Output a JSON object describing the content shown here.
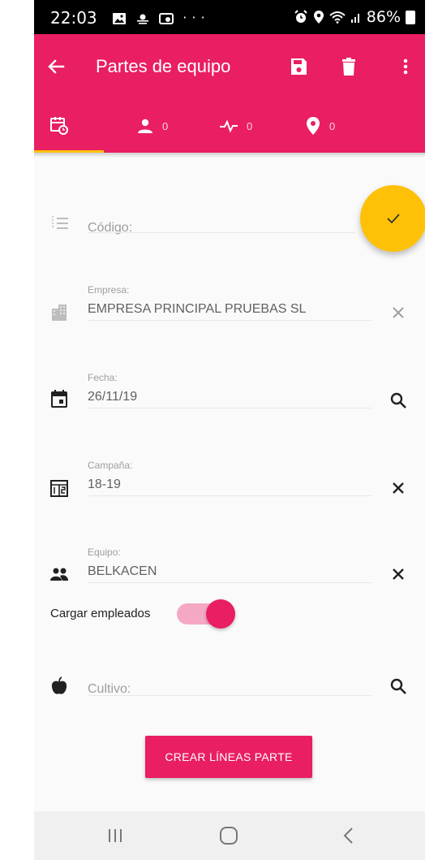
{
  "status_bar": {
    "time": "22:03",
    "left_icons": [
      "gallery-icon",
      "weather-icon",
      "gamepad-icon",
      "more-notifications-icon"
    ],
    "more_glyph": "···",
    "battery": "86%",
    "right_icons": [
      "alarm-icon",
      "location-icon",
      "wifi-icon",
      "signal-icon",
      "battery-icon"
    ]
  },
  "app_bar": {
    "title": "Partes de equipo",
    "icons": [
      "back-arrow-icon",
      "save-icon",
      "delete-icon",
      "more-vert-icon"
    ],
    "background": "#e91e63"
  },
  "tabs": [
    {
      "icon": "calendar-clock-icon",
      "count": ""
    },
    {
      "icon": "person-icon",
      "count": "0"
    },
    {
      "icon": "activity-icon",
      "count": "0"
    },
    {
      "icon": "location-pin-icon",
      "count": "0"
    }
  ],
  "tab_indicator_color": "#ffc107",
  "fab": {
    "icon": "check-icon",
    "color": "#ffc107"
  },
  "form": {
    "codigo": {
      "placeholder": "Código:",
      "icon": "list-icon"
    },
    "empresa": {
      "label": "Empresa:",
      "value": "EMPRESA PRINCIPAL PRUEBAS SL",
      "icon": "building-icon",
      "action_icon": "clear-icon"
    },
    "fecha": {
      "label": "Fecha:",
      "value": "26/11/19",
      "icon": "event-icon",
      "action_icon": "search-icon"
    },
    "campana": {
      "label": "Campaña:",
      "value": "18-19",
      "icon": "calendar-range-icon",
      "action_icon": "clear-icon"
    },
    "equipo": {
      "label": "Equipo:",
      "value": "BELKACEN",
      "icon": "group-icon",
      "action_icon": "clear-icon"
    },
    "cargar_empleados": {
      "label": "Cargar empleados",
      "enabled": true
    },
    "cultivo": {
      "placeholder": "Cultivo:",
      "icon": "apple-icon",
      "action_icon": "search-icon"
    }
  },
  "create_button": {
    "label": "CREAR LÍNEAS PARTE"
  },
  "nav_bar": [
    "recents-icon",
    "home-icon",
    "back-icon"
  ],
  "accent_color": "#e91e63"
}
